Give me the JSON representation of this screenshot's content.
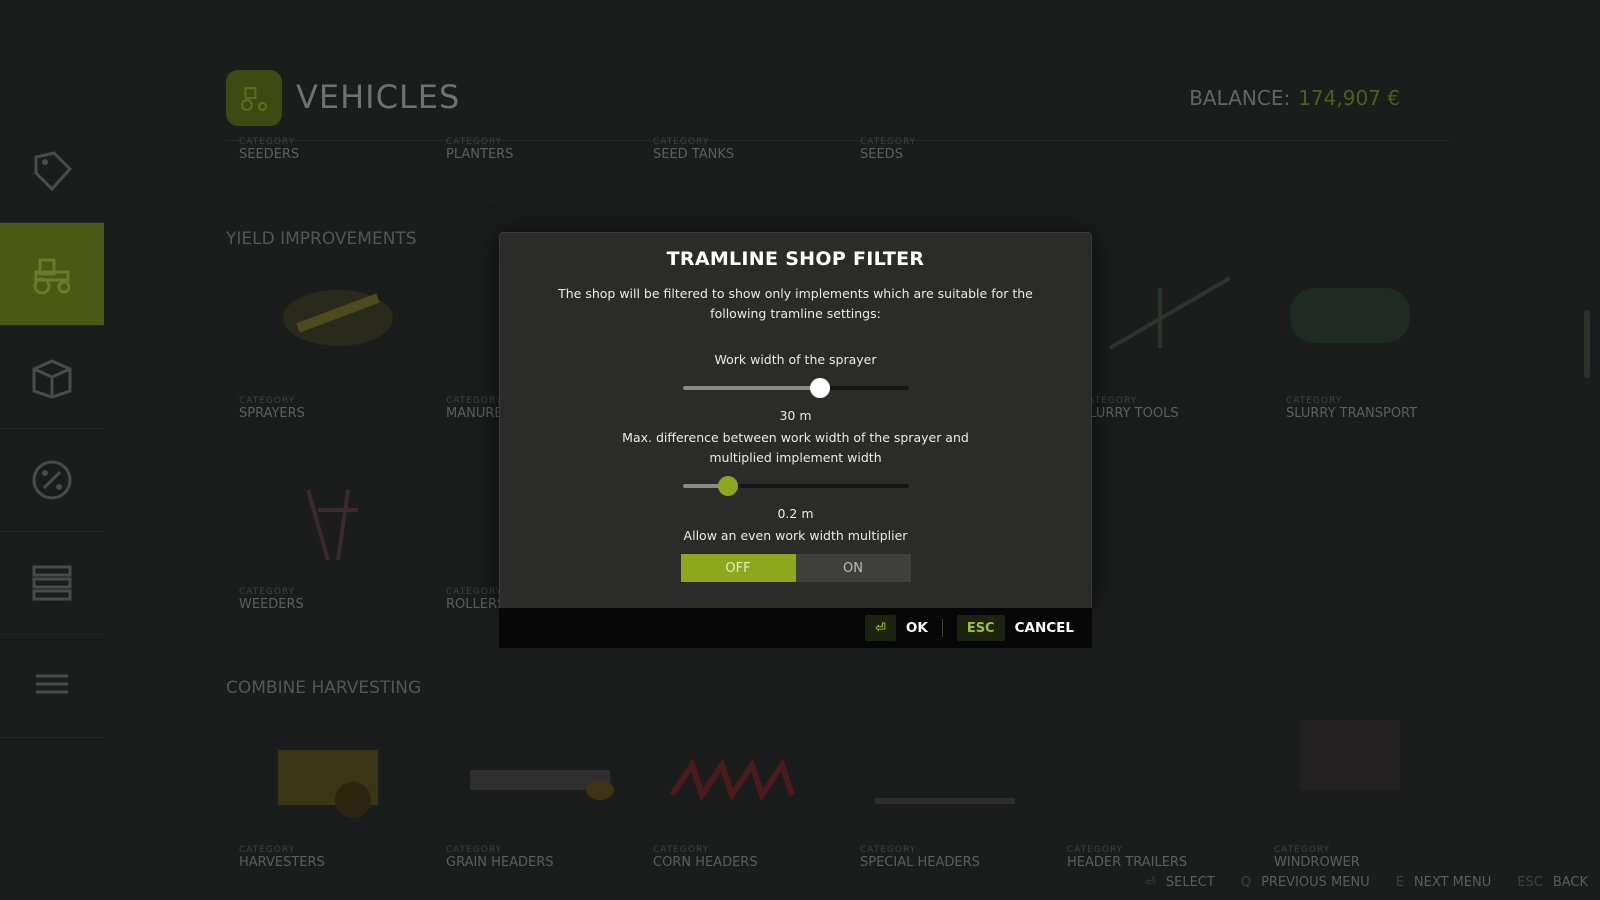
{
  "header": {
    "title": "VEHICLES",
    "balance_label": "BALANCE:",
    "balance_value": "174,907 €"
  },
  "colors": {
    "accent": "#8ea81d",
    "dialog_bg": "#2b2b2a",
    "button_bar": "#070707"
  },
  "sidebar": {
    "items": [
      {
        "icon": "price-tag-icon"
      },
      {
        "icon": "tractor-icon",
        "active": true
      },
      {
        "icon": "box-icon"
      },
      {
        "icon": "percent-icon"
      },
      {
        "icon": "list-icon"
      },
      {
        "icon": "menu-icon"
      }
    ]
  },
  "background": {
    "top_row": [
      {
        "small": "CATEGORY",
        "name": "SEEDERS"
      },
      {
        "small": "CATEGORY",
        "name": "PLANTERS"
      },
      {
        "small": "CATEGORY",
        "name": "SEED TANKS"
      },
      {
        "small": "CATEGORY",
        "name": "SEEDS"
      }
    ],
    "yield_title": "YIELD IMPROVEMENTS",
    "row1": [
      {
        "small": "CATEGORY",
        "name": "SPRAYERS"
      },
      {
        "small": "CATEGORY",
        "name": "MANURE"
      },
      {
        "small": "CATEGORY",
        "name": "SLURRY TOOLS"
      },
      {
        "small": "CATEGORY",
        "name": "SLURRY TRANSPORT"
      }
    ],
    "row2": [
      {
        "small": "CATEGORY",
        "name": "WEEDERS"
      },
      {
        "small": "CATEGORY",
        "name": "ROLLERS"
      }
    ],
    "combine_title": "COMBINE HARVESTING",
    "row3": [
      {
        "small": "CATEGORY",
        "name": "HARVESTERS"
      },
      {
        "small": "CATEGORY",
        "name": "GRAIN HEADERS"
      },
      {
        "small": "CATEGORY",
        "name": "CORN HEADERS"
      },
      {
        "small": "CATEGORY",
        "name": "SPECIAL HEADERS"
      },
      {
        "small": "CATEGORY",
        "name": "HEADER TRAILERS"
      },
      {
        "small": "CATEGORY",
        "name": "WINDROWER"
      }
    ]
  },
  "footer": {
    "select": "SELECT",
    "prev_key": "Q",
    "prev": "PREVIOUS MENU",
    "next_key": "E",
    "next": "NEXT MENU",
    "back_key": "ESC",
    "back": "BACK"
  },
  "dialog": {
    "title": "TRAMLINE SHOP FILTER",
    "description": "The shop will be filtered to show only implements which are suitable for the following tramline settings:",
    "slider1_label": "Work width of the sprayer",
    "slider1_value": "30 m",
    "slider1_position": 0.61,
    "slider2_label": "Max. difference between work width of the sprayer and multiplied implement width",
    "slider2_value": "0.2 m",
    "slider2_position": 0.2,
    "toggle_label": "Allow an even work width multiplier",
    "toggle_off": "OFF",
    "toggle_on": "ON",
    "toggle_selected": "OFF",
    "ok_key": "⏎",
    "ok_label": "OK",
    "cancel_key": "ESC",
    "cancel_label": "CANCEL"
  }
}
